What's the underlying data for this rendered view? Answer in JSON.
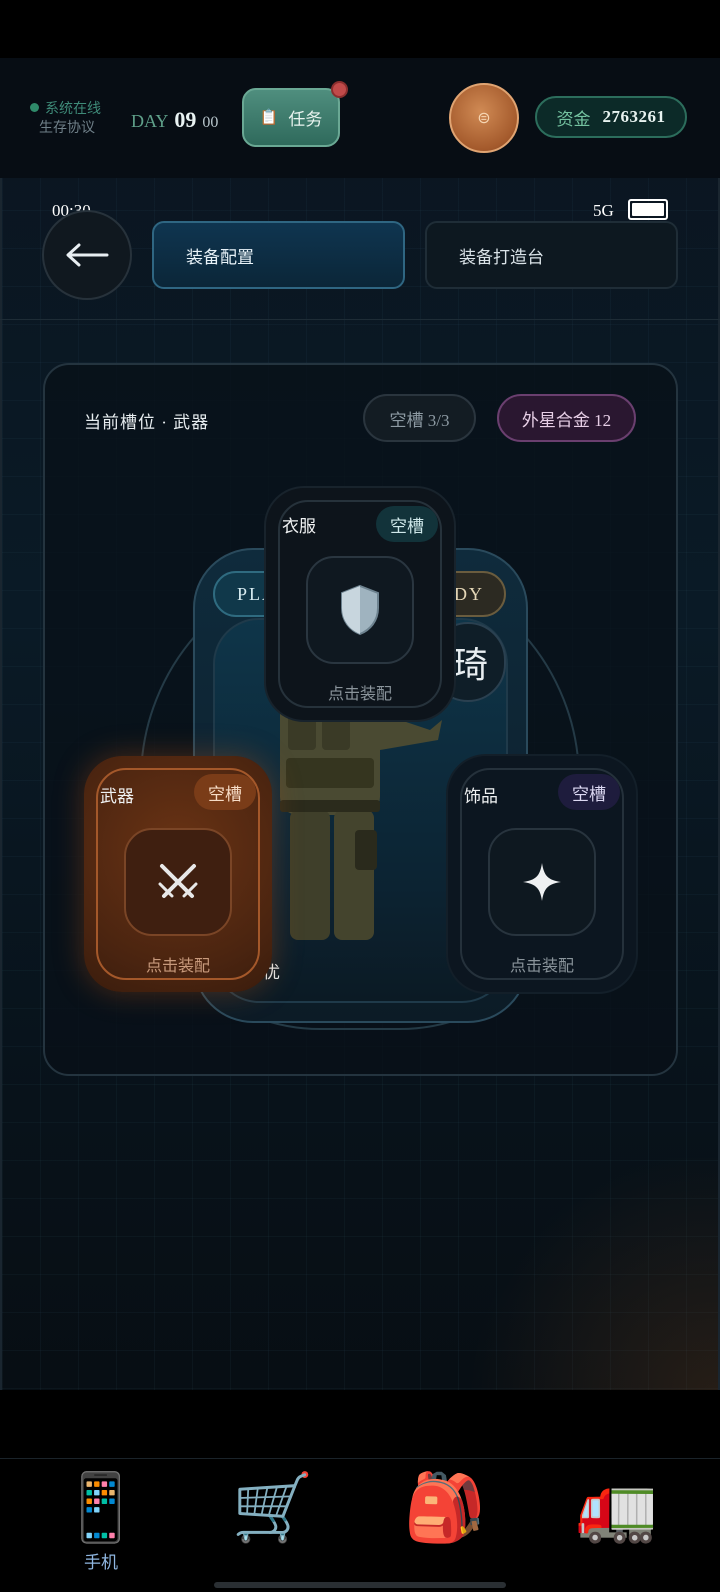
{
  "status": {
    "online_label": "系统在线",
    "protocol_label": "生存协议",
    "day_prefix": "DAY",
    "day_number": "09",
    "day_minutes": "00",
    "task_label": "任务",
    "funds_label": "资金",
    "funds_value": "2763261"
  },
  "system_bar": {
    "time": "00:30",
    "network": "5G",
    "battery_percent": 100
  },
  "header": {
    "tabs": [
      {
        "label": "装备配置",
        "active": true
      },
      {
        "label": "装备打造台",
        "active": false
      }
    ]
  },
  "equipment": {
    "current_slot": "当前槽位 · 武器",
    "empty_slots": "空槽 3/3",
    "alien_alloy": "外星合金 12",
    "player_tag": "PLA",
    "ready_tag": "ADY",
    "name_glyph": "琦",
    "name_line": "优",
    "slots": {
      "clothes": {
        "title": "衣服",
        "badge": "空槽",
        "action": "点击装配",
        "icon": "shield-icon"
      },
      "weapon": {
        "title": "武器",
        "badge": "空槽",
        "action": "点击装配",
        "icon": "crossed-swords-icon"
      },
      "accessory": {
        "title": "饰品",
        "badge": "空槽",
        "action": "点击装配",
        "icon": "sparkle-icon"
      }
    }
  },
  "bottom_nav": {
    "items": [
      {
        "icon": "phone-icon",
        "glyph": "📱",
        "label": "手机"
      },
      {
        "icon": "cart-icon",
        "glyph": "🛒",
        "label": ""
      },
      {
        "icon": "backpack-icon",
        "glyph": "🎒",
        "label": ""
      },
      {
        "icon": "truck-icon",
        "glyph": "🚛",
        "label": ""
      }
    ]
  },
  "colors": {
    "accent_teal": "#2c6d5c",
    "weapon_orange": "#a4582a",
    "alloy_purple": "#6a3f6f"
  }
}
